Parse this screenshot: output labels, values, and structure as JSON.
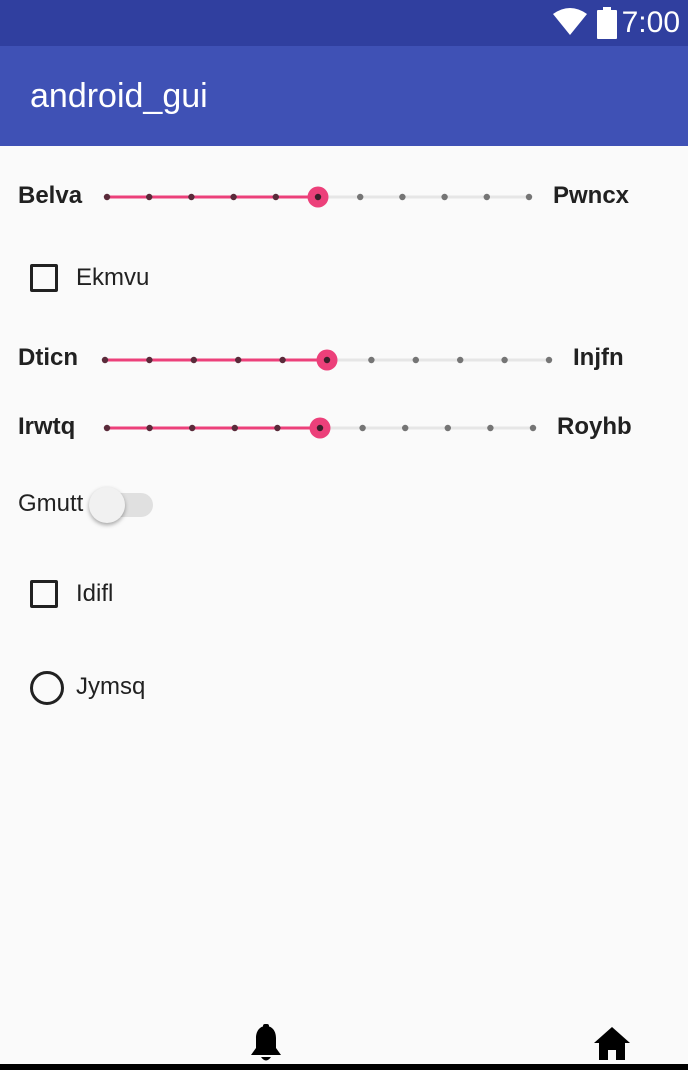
{
  "status_bar": {
    "time": "7:00",
    "icons": [
      "wifi-icon",
      "battery-icon"
    ],
    "color": "#303f9f"
  },
  "app_bar": {
    "title": "android_gui",
    "color": "#3f51b5"
  },
  "accent_color": "#ec407a",
  "sliders": [
    {
      "left_label": "Belva",
      "right_label": "Pwncx",
      "value": 5,
      "max": 10
    },
    {
      "left_label": "Dticn",
      "right_label": "Injfn",
      "value": 5,
      "max": 10
    },
    {
      "left_label": "Irwtq",
      "right_label": "Royhb",
      "value": 5,
      "max": 10
    }
  ],
  "checkboxes": [
    {
      "label": "Ekmvu",
      "checked": false
    },
    {
      "label": "Idifl",
      "checked": false
    }
  ],
  "switch": {
    "label": "Gmutt",
    "on": false
  },
  "radio": {
    "label": "Jymsq",
    "selected": false
  },
  "bottom_nav": {
    "icons": [
      "bell-icon",
      "home-icon"
    ]
  }
}
